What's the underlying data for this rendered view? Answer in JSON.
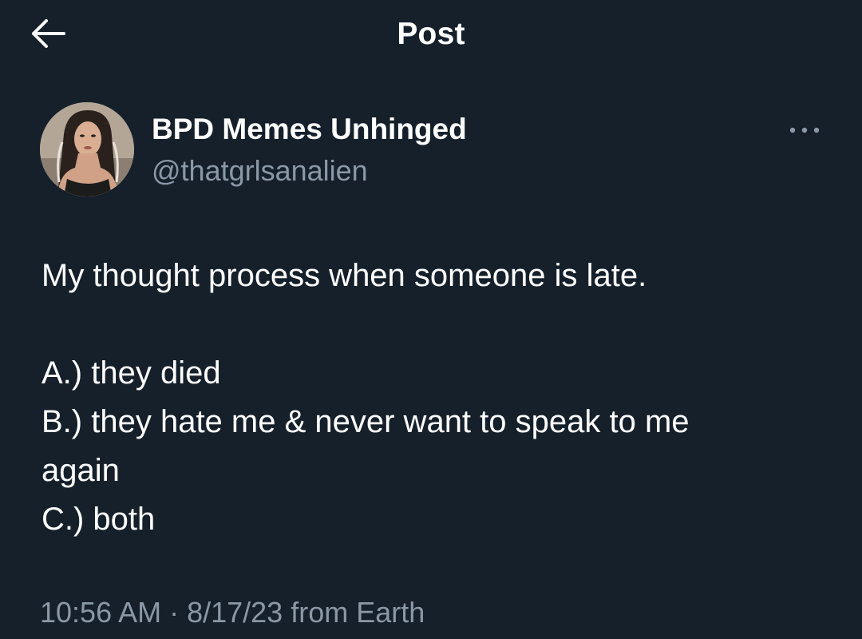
{
  "header": {
    "title": "Post",
    "back_icon": "arrow-left-icon"
  },
  "author": {
    "display_name": "BPD Memes Unhinged",
    "handle": "@thatgrlsanalien",
    "avatar_icon": "avatar-photo",
    "more_icon": "more-horizontal-icon"
  },
  "post": {
    "lines": [
      "My thought process when someone is late.",
      "",
      "A.) they died",
      "B.) they hate me & never want to speak to me",
      "again",
      "C.) both"
    ]
  },
  "meta": {
    "timestamp": "10:56 AM · 8/17/23 from Earth"
  },
  "colors": {
    "background": "#15202b",
    "text_primary": "#ffffff",
    "text_secondary": "#8b98a5"
  }
}
